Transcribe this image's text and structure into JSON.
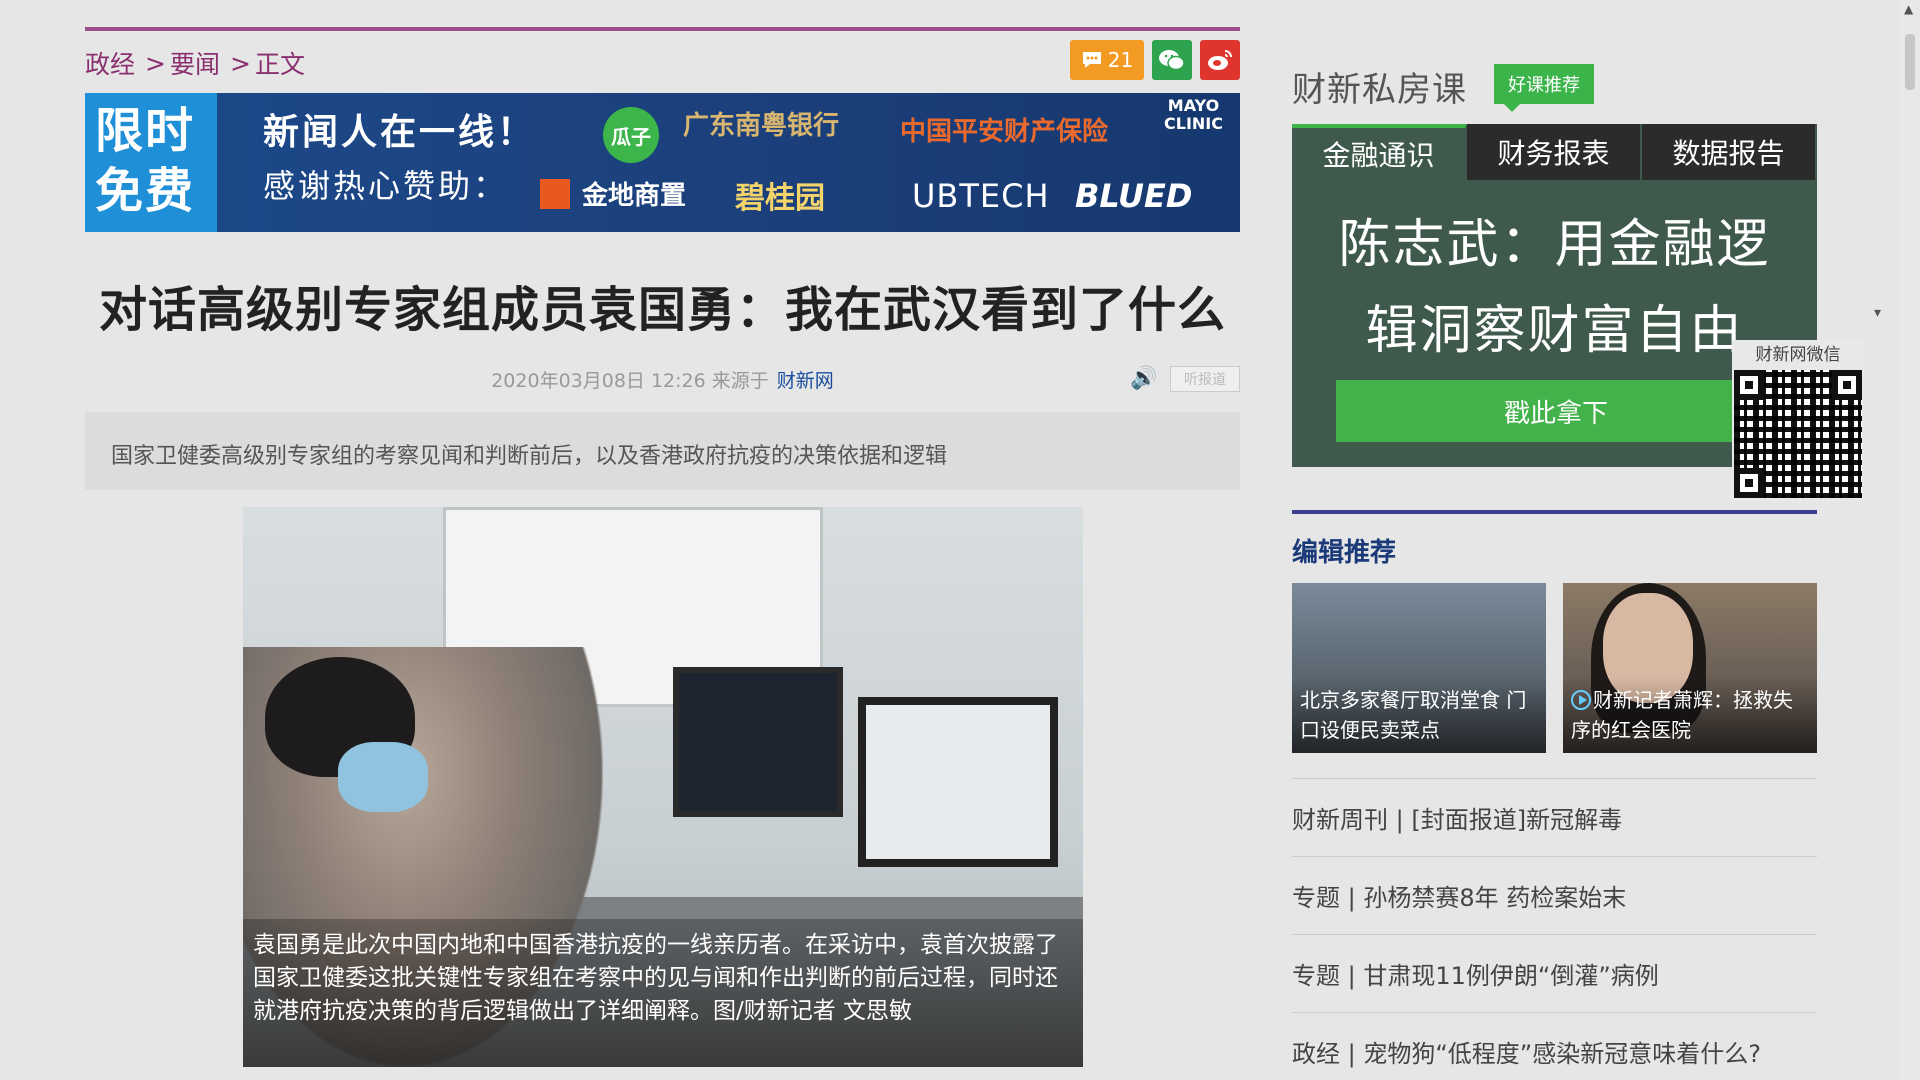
{
  "breadcrumb": {
    "items": [
      "政经",
      "要闻",
      "正文"
    ],
    "sep": ">"
  },
  "share": {
    "comment_count": "21",
    "comment_icon": "comment-icon",
    "wechat_icon": "wechat-icon",
    "weibo_icon": "weibo-icon"
  },
  "banner": {
    "free_label": "限时免费",
    "line1": "新闻人在一线！",
    "line2": "感谢热心赞助：",
    "sponsors": [
      "瓜子",
      "广东南粤银行",
      "中国平安财产保险",
      "MAYO CLINIC",
      "金地商置",
      "碧桂园",
      "UBTECH",
      "BLUED"
    ]
  },
  "article": {
    "title": "对话高级别专家组成员袁国勇：我在武汉看到了什么",
    "date": "2020年03月08日 12:26 来源于",
    "source": "财新网",
    "listen_label": "听报道",
    "summary": "国家卫健委高级别专家组的考察见闻和判断前后，以及香港政府抗疫的决策依据和逻辑",
    "photo_caption": "袁国勇是此次中国内地和中国香港抗疫的一线亲历者。在采访中，袁首次披露了国家卫健委这批关键性专家组在考察中的见与闻和作出判断的前后过程，同时还就港府抗疫决策的背后逻辑做出了详细阐释。图/财新记者 文思敏"
  },
  "sidebar": {
    "course_title": "财新私房课",
    "course_badge": "好课推荐",
    "tabs": [
      "金融通识",
      "财务报表",
      "数据报告"
    ],
    "course_headline_1": "陈志武：用金融逻",
    "course_headline_2": "辑洞察财富自由",
    "course_cta": "戳此拿下",
    "qr_label": "财新网微信",
    "section_title": "编辑推荐",
    "thumbs": [
      {
        "caption": "北京多家餐厅取消堂食 门口设便民卖菜点"
      },
      {
        "caption": "财新记者萧辉：拯救失序的红会医院"
      }
    ],
    "links": [
      "财新周刊 | [封面报道]新冠解毒",
      "专题 | 孙杨禁赛8年 药检案始末",
      "专题 | 甘肃现11例伊朗“倒灌”病例",
      "政经 | 宠物狗“低程度”感染新冠意味着什么?"
    ]
  },
  "colors": {
    "accent": "#8a3070",
    "link_blue": "#1b4fa0",
    "green": "#3bb54a"
  }
}
